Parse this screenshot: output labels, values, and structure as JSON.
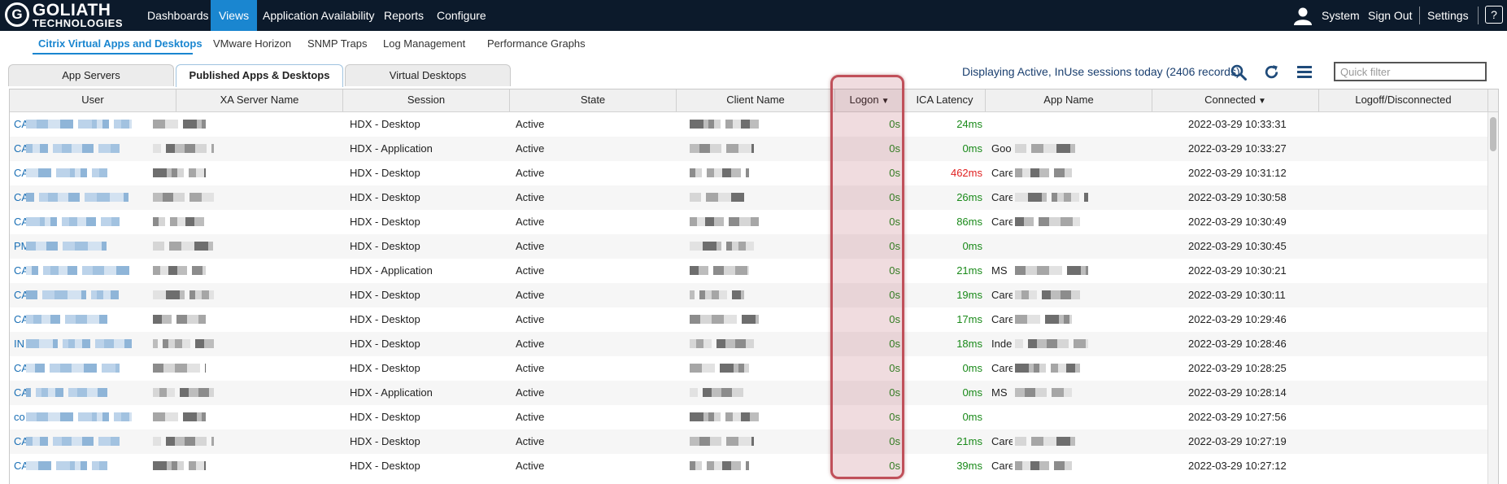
{
  "brand": {
    "logo_letter": "G",
    "line1": "GOLIATH",
    "line2": "TECHNOLOGIES"
  },
  "topnav": {
    "items": [
      "Dashboards",
      "Views",
      "Application Availability",
      "Reports",
      "Configure"
    ],
    "active": "Views",
    "right": {
      "user": "System",
      "signout": "Sign Out",
      "settings": "Settings",
      "help": "?"
    }
  },
  "subnav": {
    "items": [
      "Citrix Virtual Apps and Desktops",
      "VMware Horizon",
      "SNMP Traps",
      "Log Management",
      "Performance Graphs"
    ],
    "active": "Citrix Virtual Apps and Desktops"
  },
  "tabs": {
    "items": [
      "App Servers",
      "Published Apps & Desktops",
      "Virtual Desktops"
    ],
    "active": "Published Apps & Desktops"
  },
  "toolbar": {
    "status": "Displaying Active, InUse sessions today (2406 records)",
    "quick_filter_placeholder": "Quick filter",
    "icons": [
      "search-icon",
      "refresh-icon",
      "menu-icon"
    ]
  },
  "grid": {
    "columns": [
      "User",
      "XA Server Name",
      "Session",
      "State",
      "Client Name",
      "Logon",
      "ICA Latency",
      "App Name",
      "Connected",
      "Logoff/Disconnected"
    ],
    "sorted_columns": [
      "Logon",
      "Connected"
    ],
    "rows": [
      {
        "user": "CA",
        "session": "HDX - Desktop",
        "state": "Active",
        "logon": "0s",
        "ica": "24ms",
        "ica_status": "ok",
        "app": "",
        "connected": "2022-03-29 10:33:31",
        "logoff": ""
      },
      {
        "user": "CA",
        "session": "HDX - Application",
        "state": "Active",
        "logon": "0s",
        "ica": "0ms",
        "ica_status": "ok",
        "app": "Goo",
        "connected": "2022-03-29 10:33:27",
        "logoff": ""
      },
      {
        "user": "CA",
        "session": "HDX - Desktop",
        "state": "Active",
        "logon": "0s",
        "ica": "462ms",
        "ica_status": "bad",
        "app": "Care",
        "connected": "2022-03-29 10:31:12",
        "logoff": ""
      },
      {
        "user": "CA",
        "session": "HDX - Desktop",
        "state": "Active",
        "logon": "0s",
        "ica": "26ms",
        "ica_status": "ok",
        "app": "Care",
        "connected": "2022-03-29 10:30:58",
        "logoff": ""
      },
      {
        "user": "CA",
        "session": "HDX - Desktop",
        "state": "Active",
        "logon": "0s",
        "ica": "86ms",
        "ica_status": "ok",
        "app": "Care",
        "connected": "2022-03-29 10:30:49",
        "logoff": ""
      },
      {
        "user": "PM",
        "session": "HDX - Desktop",
        "state": "Active",
        "logon": "0s",
        "ica": "0ms",
        "ica_status": "ok",
        "app": "",
        "connected": "2022-03-29 10:30:45",
        "logoff": ""
      },
      {
        "user": "CA",
        "session": "HDX - Application",
        "state": "Active",
        "logon": "0s",
        "ica": "21ms",
        "ica_status": "ok",
        "app": "MS",
        "connected": "2022-03-29 10:30:21",
        "logoff": ""
      },
      {
        "user": "CA",
        "session": "HDX - Desktop",
        "state": "Active",
        "logon": "0s",
        "ica": "19ms",
        "ica_status": "ok",
        "app": "Care",
        "connected": "2022-03-29 10:30:11",
        "logoff": ""
      },
      {
        "user": "CA",
        "session": "HDX - Desktop",
        "state": "Active",
        "logon": "0s",
        "ica": "17ms",
        "ica_status": "ok",
        "app": "Care",
        "connected": "2022-03-29 10:29:46",
        "logoff": ""
      },
      {
        "user": "IN",
        "session": "HDX - Desktop",
        "state": "Active",
        "logon": "0s",
        "ica": "18ms",
        "ica_status": "ok",
        "app": "Inde",
        "connected": "2022-03-29 10:28:46",
        "logoff": ""
      },
      {
        "user": "CA",
        "session": "HDX - Desktop",
        "state": "Active",
        "logon": "0s",
        "ica": "0ms",
        "ica_status": "ok",
        "app": "Care",
        "connected": "2022-03-29 10:28:25",
        "logoff": ""
      },
      {
        "user": "CA",
        "session": "HDX - Application",
        "state": "Active",
        "logon": "0s",
        "ica": "0ms",
        "ica_status": "ok",
        "app": "MS",
        "connected": "2022-03-29 10:28:14",
        "logoff": ""
      },
      {
        "user": "co",
        "session": "HDX - Desktop",
        "state": "Active",
        "logon": "0s",
        "ica": "0ms",
        "ica_status": "ok",
        "app": "",
        "connected": "2022-03-29 10:27:56",
        "logoff": ""
      },
      {
        "user": "CA",
        "session": "HDX - Desktop",
        "state": "Active",
        "logon": "0s",
        "ica": "21ms",
        "ica_status": "ok",
        "app": "Care",
        "connected": "2022-03-29 10:27:19",
        "logoff": ""
      },
      {
        "user": "CA",
        "session": "HDX - Desktop",
        "state": "Active",
        "logon": "0s",
        "ica": "39ms",
        "ica_status": "ok",
        "app": "Care",
        "connected": "2022-03-29 10:27:12",
        "logoff": ""
      }
    ]
  },
  "colors": {
    "nav_bg": "#0c1a2b",
    "accent": "#1a86d0",
    "ok": "#1a8a1a",
    "bad": "#e02020",
    "highlight": "#c0505a",
    "user_link": "#1a6fb5"
  }
}
